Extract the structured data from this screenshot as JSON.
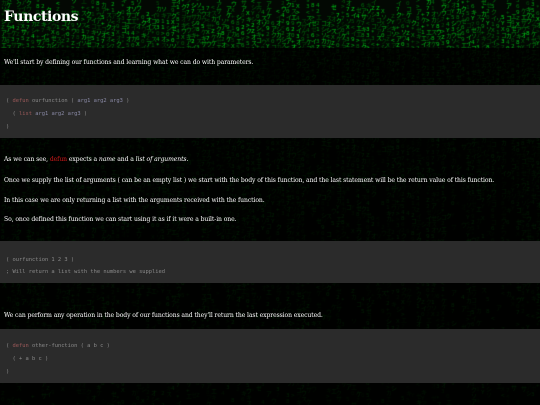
{
  "page": {
    "title": "Functions",
    "accent_color": "#d11a1a",
    "code_background": "#2b2b2b"
  },
  "intro": "We'll start by defining our functions and learning what we can do with parameters.",
  "code1": {
    "line1": {
      "open": "( ",
      "kw": "defun",
      "name": " ourfunction ( ",
      "params": "arg1 arg2 arg3",
      "close": " )"
    },
    "line2": {
      "pre": "  ( ",
      "kw": "list",
      "args": " arg1 arg2 arg3",
      "post": " )"
    },
    "line3": ")"
  },
  "desc1": {
    "pre": "As we can see, ",
    "kw": "defun",
    "mid1": " expects a ",
    "em1": "name",
    "mid2": " and a ",
    "em2": "list of arguments",
    "post": "."
  },
  "desc2": "Once we supply the list of arguments ( can be an empty list ) we start with the body of this function, and the last statement will be the return value of this function.",
  "desc3": "In this case we are only returning a list with the arguments received with the function.",
  "desc4": "So, once defined this function we can start using it as if it were a built-in one.",
  "code2": {
    "line1": "( ourfunction 1 2 3 )",
    "line2": "; Will return a list with the numbers we supplied"
  },
  "desc5": "We can perform any operation in the body of our functions and they'll return the last expression executed.",
  "code3": {
    "line1": {
      "open": "( ",
      "kw": "defun",
      "rest": " other-function ( a b c )"
    },
    "line2": "  ( + a b c )",
    "line3": ")"
  }
}
